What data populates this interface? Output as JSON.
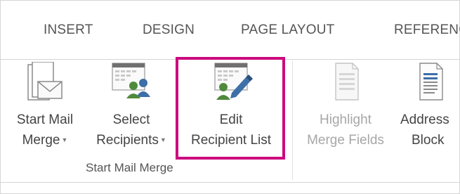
{
  "tabs": [
    "INSERT",
    "DESIGN",
    "PAGE LAYOUT",
    "REFERENC"
  ],
  "commands": {
    "start_mail_merge": {
      "line1": "Start Mail",
      "line2": "Merge"
    },
    "select_recipients": {
      "line1": "Select",
      "line2": "Recipients"
    },
    "edit_recipient_list": {
      "line1": "Edit",
      "line2": "Recipient List"
    },
    "highlight_merge_fields": {
      "line1": "Highlight",
      "line2": "Merge Fields"
    },
    "address_block": {
      "line1": "Address",
      "line2": "Block"
    }
  },
  "group_label": "Start Mail Merge",
  "colors": {
    "highlight": "#cc0b7e",
    "icon_green": "#4f8a3c",
    "icon_blue": "#3d6fa8",
    "disabled_text": "#a7a7a7"
  },
  "icons": [
    "mail-merge-envelope-icon",
    "recipients-icon",
    "edit-recipients-icon",
    "highlight-fields-icon",
    "address-block-icon"
  ]
}
